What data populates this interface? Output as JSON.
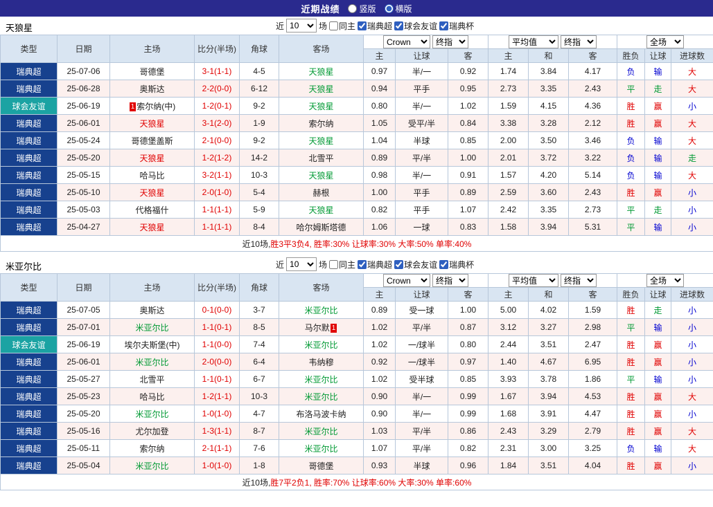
{
  "topbar": {
    "title": "近期战绩",
    "vertical_label": "竖版",
    "horizontal_label": "横版",
    "vertical_checked": false,
    "horizontal_checked": true
  },
  "filters": {
    "near_label": "近",
    "matches_count": "10",
    "matches_label": "场",
    "checkboxes": [
      {
        "label": "同主",
        "checked": false
      },
      {
        "label": "瑞典超",
        "checked": true
      },
      {
        "label": "球会友谊",
        "checked": true
      },
      {
        "label": "瑞典杯",
        "checked": true
      }
    ]
  },
  "selects": {
    "bookmaker": "Crown",
    "final1": "终指",
    "average": "平均值",
    "final2": "终指",
    "fullmatch": "全场"
  },
  "columns": [
    "类型",
    "日期",
    "主场",
    "比分(半场)",
    "角球",
    "客场",
    "主",
    "让球",
    "客",
    "主",
    "和",
    "客",
    "胜负",
    "让球",
    "进球数"
  ],
  "sections": [
    {
      "team": "天狼星",
      "rows": [
        {
          "league": "瑞典超",
          "cat": "super",
          "date": "25-07-06",
          "home": "哥德堡",
          "homeColor": "",
          "score": "3-1(1-1)",
          "corner": "4-5",
          "away": "天狼星",
          "awayColor": "green",
          "hOdds": "0.97",
          "line": "半/一",
          "aOdds": "0.92",
          "euroH": "1.74",
          "euroD": "3.84",
          "euroA": "4.17",
          "res": "负",
          "resLine": "输",
          "resGoals": "大"
        },
        {
          "league": "瑞典超",
          "cat": "super",
          "date": "25-06-28",
          "home": "奥斯达",
          "homeColor": "",
          "score": "2-2(0-0)",
          "corner": "6-12",
          "away": "天狼星",
          "awayColor": "green",
          "hOdds": "0.94",
          "line": "平手",
          "aOdds": "0.95",
          "euroH": "2.73",
          "euroD": "3.35",
          "euroA": "2.43",
          "res": "平",
          "resLine": "走",
          "resGoals": "大"
        },
        {
          "league": "球会友谊",
          "cat": "friendly",
          "date": "25-06-19",
          "home": "索尔纳(中)",
          "homeColor": "",
          "homeBadge": "1",
          "homeBadgePos": "before",
          "score": "1-2(0-1)",
          "corner": "9-2",
          "away": "天狼星",
          "awayColor": "green",
          "hOdds": "0.80",
          "line": "半/一",
          "aOdds": "1.02",
          "euroH": "1.59",
          "euroD": "4.15",
          "euroA": "4.36",
          "res": "胜",
          "resLine": "赢",
          "resGoals": "小"
        },
        {
          "league": "瑞典超",
          "cat": "super",
          "date": "25-06-01",
          "home": "天狼星",
          "homeColor": "red",
          "score": "3-1(2-0)",
          "corner": "1-9",
          "away": "索尔纳",
          "awayColor": "",
          "hOdds": "1.05",
          "line": "受平/半",
          "aOdds": "0.84",
          "euroH": "3.38",
          "euroD": "3.28",
          "euroA": "2.12",
          "res": "胜",
          "resLine": "赢",
          "resGoals": "大"
        },
        {
          "league": "瑞典超",
          "cat": "super",
          "date": "25-05-24",
          "home": "哥德堡盖斯",
          "homeColor": "",
          "score": "2-1(0-0)",
          "corner": "9-2",
          "away": "天狼星",
          "awayColor": "green",
          "hOdds": "1.04",
          "line": "半球",
          "aOdds": "0.85",
          "euroH": "2.00",
          "euroD": "3.50",
          "euroA": "3.46",
          "res": "负",
          "resLine": "输",
          "resGoals": "大"
        },
        {
          "league": "瑞典超",
          "cat": "super",
          "date": "25-05-20",
          "home": "天狼星",
          "homeColor": "red",
          "score": "1-2(1-2)",
          "corner": "14-2",
          "away": "北雪平",
          "awayColor": "",
          "hOdds": "0.89",
          "line": "平/半",
          "aOdds": "1.00",
          "euroH": "2.01",
          "euroD": "3.72",
          "euroA": "3.22",
          "res": "负",
          "resLine": "输",
          "resGoals": "走"
        },
        {
          "league": "瑞典超",
          "cat": "super",
          "date": "25-05-15",
          "home": "哈马比",
          "homeColor": "",
          "score": "3-2(1-1)",
          "corner": "10-3",
          "away": "天狼星",
          "awayColor": "green",
          "hOdds": "0.98",
          "line": "半/一",
          "aOdds": "0.91",
          "euroH": "1.57",
          "euroD": "4.20",
          "euroA": "5.14",
          "res": "负",
          "resLine": "输",
          "resGoals": "大"
        },
        {
          "league": "瑞典超",
          "cat": "super",
          "date": "25-05-10",
          "home": "天狼星",
          "homeColor": "red",
          "score": "2-0(1-0)",
          "corner": "5-4",
          "away": "赫根",
          "awayColor": "",
          "hOdds": "1.00",
          "line": "平手",
          "aOdds": "0.89",
          "euroH": "2.59",
          "euroD": "3.60",
          "euroA": "2.43",
          "res": "胜",
          "resLine": "赢",
          "resGoals": "小"
        },
        {
          "league": "瑞典超",
          "cat": "super",
          "date": "25-05-03",
          "home": "代格福什",
          "homeColor": "",
          "score": "1-1(1-1)",
          "corner": "5-9",
          "away": "天狼星",
          "awayColor": "green",
          "hOdds": "0.82",
          "line": "平手",
          "aOdds": "1.07",
          "euroH": "2.42",
          "euroD": "3.35",
          "euroA": "2.73",
          "res": "平",
          "resLine": "走",
          "resGoals": "小"
        },
        {
          "league": "瑞典超",
          "cat": "super",
          "date": "25-04-27",
          "home": "天狼星",
          "homeColor": "red",
          "score": "1-1(1-1)",
          "corner": "8-4",
          "away": "哈尔姆斯塔德",
          "awayColor": "",
          "hOdds": "1.06",
          "line": "一球",
          "aOdds": "0.83",
          "euroH": "1.58",
          "euroD": "3.94",
          "euroA": "5.31",
          "res": "平",
          "resLine": "输",
          "resGoals": "小"
        }
      ],
      "summary": {
        "prefix": "近10场,",
        "stats": "胜3平3负4, 胜率:30% 让球率:30% 大率:50% 单率:40%"
      }
    },
    {
      "team": "米亚尔比",
      "rows": [
        {
          "league": "瑞典超",
          "cat": "super",
          "date": "25-07-05",
          "home": "奥斯达",
          "homeColor": "",
          "score": "0-1(0-0)",
          "corner": "3-7",
          "away": "米亚尔比",
          "awayColor": "green",
          "hOdds": "0.89",
          "line": "受一球",
          "aOdds": "1.00",
          "euroH": "5.00",
          "euroD": "4.02",
          "euroA": "1.59",
          "res": "胜",
          "resLine": "走",
          "resGoals": "小"
        },
        {
          "league": "瑞典超",
          "cat": "super",
          "date": "25-07-01",
          "home": "米亚尔比",
          "homeColor": "green",
          "score": "1-1(0-1)",
          "corner": "8-5",
          "away": "马尔默",
          "awayColor": "",
          "awayBadge": "1",
          "awayBadgePos": "after",
          "hOdds": "1.02",
          "line": "平/半",
          "aOdds": "0.87",
          "euroH": "3.12",
          "euroD": "3.27",
          "euroA": "2.98",
          "res": "平",
          "resLine": "输",
          "resGoals": "小"
        },
        {
          "league": "球会友谊",
          "cat": "friendly",
          "date": "25-06-19",
          "home": "埃尔夫斯堡(中)",
          "homeColor": "",
          "score": "1-1(0-0)",
          "corner": "7-4",
          "away": "米亚尔比",
          "awayColor": "green",
          "hOdds": "1.02",
          "line": "一/球半",
          "aOdds": "0.80",
          "euroH": "2.44",
          "euroD": "3.51",
          "euroA": "2.47",
          "res": "胜",
          "resLine": "赢",
          "resGoals": "小"
        },
        {
          "league": "瑞典超",
          "cat": "super",
          "date": "25-06-01",
          "home": "米亚尔比",
          "homeColor": "green",
          "score": "2-0(0-0)",
          "corner": "6-4",
          "away": "韦纳穆",
          "awayColor": "",
          "hOdds": "0.92",
          "line": "一/球半",
          "aOdds": "0.97",
          "euroH": "1.40",
          "euroD": "4.67",
          "euroA": "6.95",
          "res": "胜",
          "resLine": "赢",
          "resGoals": "小"
        },
        {
          "league": "瑞典超",
          "cat": "super",
          "date": "25-05-27",
          "home": "北雪平",
          "homeColor": "",
          "score": "1-1(0-1)",
          "corner": "6-7",
          "away": "米亚尔比",
          "awayColor": "green",
          "hOdds": "1.02",
          "line": "受半球",
          "aOdds": "0.85",
          "euroH": "3.93",
          "euroD": "3.78",
          "euroA": "1.86",
          "res": "平",
          "resLine": "输",
          "resGoals": "小"
        },
        {
          "league": "瑞典超",
          "cat": "super",
          "date": "25-05-23",
          "home": "哈马比",
          "homeColor": "",
          "score": "1-2(1-1)",
          "corner": "10-3",
          "away": "米亚尔比",
          "awayColor": "green",
          "hOdds": "0.90",
          "line": "半/一",
          "aOdds": "0.99",
          "euroH": "1.67",
          "euroD": "3.94",
          "euroA": "4.53",
          "res": "胜",
          "resLine": "赢",
          "resGoals": "大"
        },
        {
          "league": "瑞典超",
          "cat": "super",
          "date": "25-05-20",
          "home": "米亚尔比",
          "homeColor": "green",
          "score": "1-0(1-0)",
          "corner": "4-7",
          "away": "布洛马波卡纳",
          "awayColor": "",
          "hOdds": "0.90",
          "line": "半/一",
          "aOdds": "0.99",
          "euroH": "1.68",
          "euroD": "3.91",
          "euroA": "4.47",
          "res": "胜",
          "resLine": "赢",
          "resGoals": "小"
        },
        {
          "league": "瑞典超",
          "cat": "super",
          "date": "25-05-16",
          "home": "尤尔加登",
          "homeColor": "",
          "score": "1-3(1-1)",
          "corner": "8-7",
          "away": "米亚尔比",
          "awayColor": "green",
          "hOdds": "1.03",
          "line": "平/半",
          "aOdds": "0.86",
          "euroH": "2.43",
          "euroD": "3.29",
          "euroA": "2.79",
          "res": "胜",
          "resLine": "赢",
          "resGoals": "大"
        },
        {
          "league": "瑞典超",
          "cat": "super",
          "date": "25-05-11",
          "home": "索尔纳",
          "homeColor": "",
          "score": "2-1(1-1)",
          "corner": "7-6",
          "away": "米亚尔比",
          "awayColor": "green",
          "hOdds": "1.07",
          "line": "平/半",
          "aOdds": "0.82",
          "euroH": "2.31",
          "euroD": "3.00",
          "euroA": "3.25",
          "res": "负",
          "resLine": "输",
          "resGoals": "大"
        },
        {
          "league": "瑞典超",
          "cat": "super",
          "date": "25-05-04",
          "home": "米亚尔比",
          "homeColor": "green",
          "score": "1-0(1-0)",
          "corner": "1-8",
          "away": "哥德堡",
          "awayColor": "",
          "hOdds": "0.93",
          "line": "半球",
          "aOdds": "0.96",
          "euroH": "1.84",
          "euroD": "3.51",
          "euroA": "4.04",
          "res": "胜",
          "resLine": "赢",
          "resGoals": "小"
        }
      ],
      "summary": {
        "prefix": "近10场,",
        "stats": "胜7平2负1, 胜率:70% 让球率:60% 大率:30% 单率:60%"
      }
    }
  ]
}
